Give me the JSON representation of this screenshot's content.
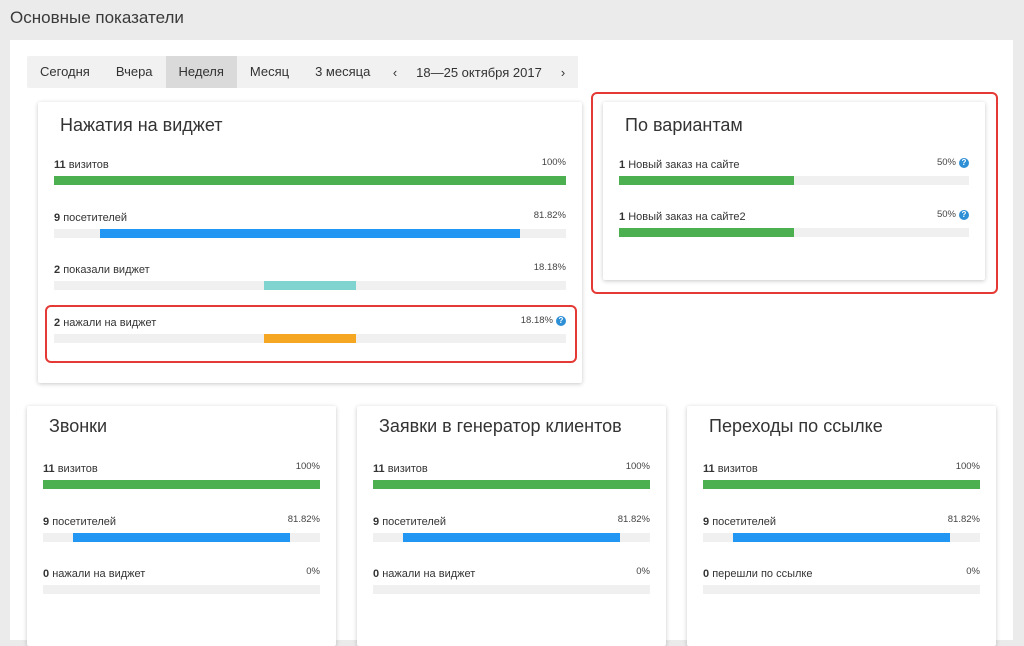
{
  "page_title": "Основные показатели",
  "tabs": [
    {
      "label": "Сегодня"
    },
    {
      "label": "Вчера"
    },
    {
      "label": "Неделя",
      "active": true
    },
    {
      "label": "Месяц"
    },
    {
      "label": "3 месяца"
    }
  ],
  "date_range": {
    "prev": "‹",
    "text": "18—25 октября 2017",
    "next": "›"
  },
  "colors": {
    "green": "#4caf50",
    "blue": "#2196f3",
    "teal": "#80d4cf",
    "orange": "#f5a623",
    "highlight": "#e53935"
  },
  "cards": {
    "widget": {
      "title": "Нажатия на виджет",
      "metrics": [
        {
          "count": "11",
          "label": "визитов",
          "pct": "100%",
          "fill_start": 0.0,
          "fill_end": 1.0,
          "color": "green"
        },
        {
          "count": "9",
          "label": "посетителей",
          "pct": "81.82%",
          "fill_start": 0.09,
          "fill_end": 0.91,
          "color": "blue"
        },
        {
          "count": "2",
          "label": "показали виджет",
          "pct": "18.18%",
          "fill_start": 0.41,
          "fill_end": 0.59,
          "color": "teal"
        },
        {
          "count": "2",
          "label": "нажали на виджет",
          "pct": "18.18%",
          "fill_start": 0.41,
          "fill_end": 0.59,
          "color": "orange",
          "help": true
        }
      ]
    },
    "variants": {
      "title": "По вариантам",
      "metrics": [
        {
          "count": "1",
          "label": "Новый заказ на сайте",
          "pct": "50%",
          "fill_start": 0.0,
          "fill_end": 0.5,
          "color": "green",
          "help": true
        },
        {
          "count": "1",
          "label": "Новый заказ на сайте2",
          "pct": "50%",
          "fill_start": 0.0,
          "fill_end": 0.5,
          "color": "green",
          "help": true
        }
      ]
    },
    "calls": {
      "title": "Звонки",
      "metrics": [
        {
          "count": "11",
          "label": "визитов",
          "pct": "100%",
          "fill_start": 0.0,
          "fill_end": 1.0,
          "color": "green"
        },
        {
          "count": "9",
          "label": "посетителей",
          "pct": "81.82%",
          "fill_start": 0.11,
          "fill_end": 0.89,
          "color": "blue"
        },
        {
          "count": "0",
          "label": "нажали на виджет",
          "pct": "0%",
          "fill_start": 0.0,
          "fill_end": 0.0,
          "color": "green"
        }
      ]
    },
    "leads": {
      "title": "Заявки в генератор клиентов",
      "metrics": [
        {
          "count": "11",
          "label": "визитов",
          "pct": "100%",
          "fill_start": 0.0,
          "fill_end": 1.0,
          "color": "green"
        },
        {
          "count": "9",
          "label": "посетителей",
          "pct": "81.82%",
          "fill_start": 0.11,
          "fill_end": 0.89,
          "color": "blue"
        },
        {
          "count": "0",
          "label": "нажали на виджет",
          "pct": "0%",
          "fill_start": 0.0,
          "fill_end": 0.0,
          "color": "green"
        }
      ]
    },
    "links": {
      "title": "Переходы по ссылке",
      "metrics": [
        {
          "count": "11",
          "label": "визитов",
          "pct": "100%",
          "fill_start": 0.0,
          "fill_end": 1.0,
          "color": "green"
        },
        {
          "count": "9",
          "label": "посетителей",
          "pct": "81.82%",
          "fill_start": 0.11,
          "fill_end": 0.89,
          "color": "blue"
        },
        {
          "count": "0",
          "label": "перешли по ссылке",
          "pct": "0%",
          "fill_start": 0.0,
          "fill_end": 0.0,
          "color": "green"
        }
      ]
    }
  }
}
